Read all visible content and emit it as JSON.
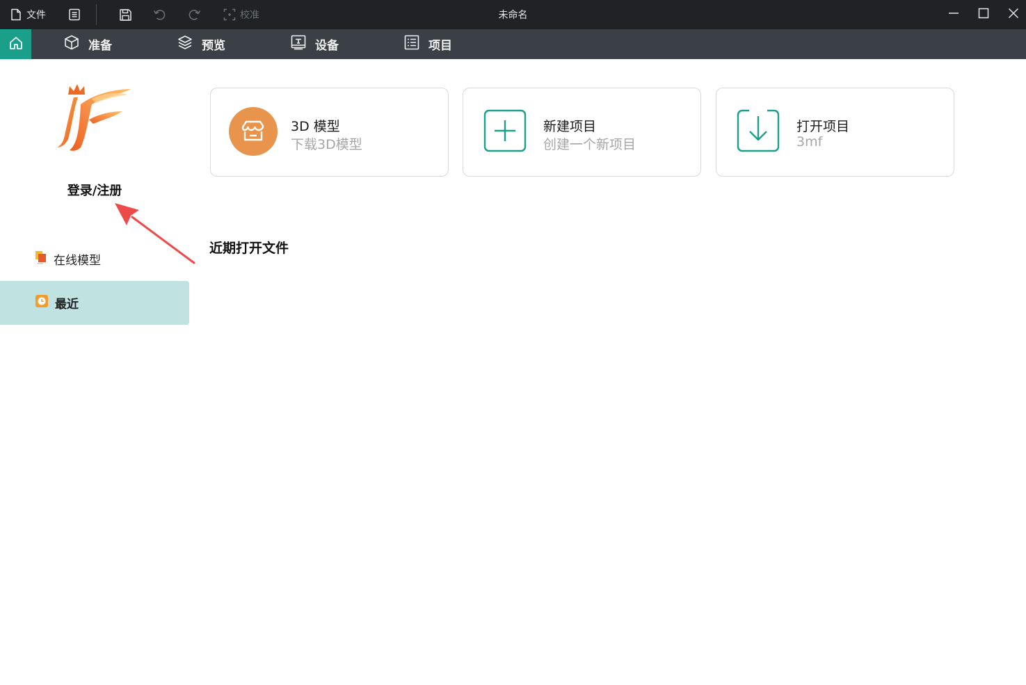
{
  "titlebar": {
    "file_label": "文件",
    "calibrate_label": "校准",
    "window_title": "未命名"
  },
  "nav": {
    "tabs": [
      {
        "label": "准备",
        "icon": "cube-icon"
      },
      {
        "label": "预览",
        "icon": "layers-icon"
      },
      {
        "label": "设备",
        "icon": "device-icon"
      },
      {
        "label": "项目",
        "icon": "list-icon"
      }
    ],
    "home_color": "#1aa08a"
  },
  "sidebar": {
    "login_label": "登录/注册",
    "items": [
      {
        "label": "在线模型",
        "icon": "online-model-icon",
        "active": false
      },
      {
        "label": "最近",
        "icon": "clock-icon",
        "active": true
      }
    ]
  },
  "cards": [
    {
      "title": "3D 模型",
      "subtitle": "下载3D模型",
      "icon": "store-icon",
      "icon_color": "#e8944d"
    },
    {
      "title": "新建项目",
      "subtitle": "创建一个新项目",
      "icon": "plus-icon",
      "icon_color": "#1aa08a"
    },
    {
      "title": "打开项目",
      "subtitle": "3mf",
      "icon": "import-icon",
      "icon_color": "#1aa08a"
    }
  ],
  "recent": {
    "heading": "近期打开文件"
  }
}
